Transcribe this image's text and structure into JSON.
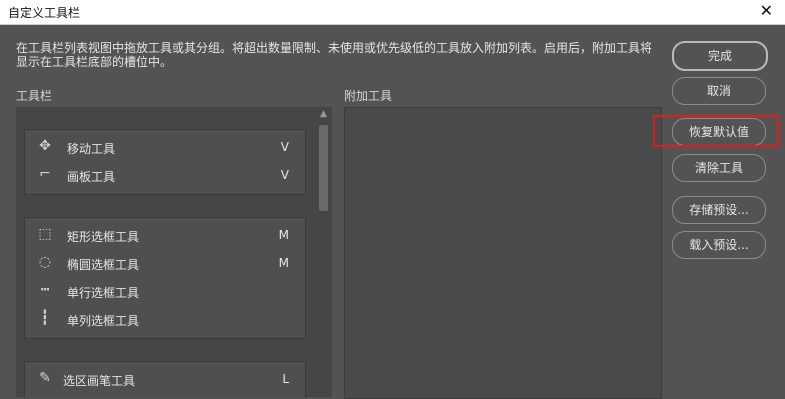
{
  "window": {
    "title": "自定义工具栏",
    "close_glyph": "✕"
  },
  "description": "在工具栏列表视图中拖放工具或其分组。将超出数量限制、未使用或优先级低的工具放入附加列表。启用后，附加工具将显示在工具栏底部的槽位中。",
  "toolbar_label": "工具栏",
  "extra_label": "附加工具",
  "groups": [
    {
      "tools": [
        {
          "icon": "move-icon",
          "glyph": "✥",
          "name": "移动工具",
          "key": "V"
        },
        {
          "icon": "artboard-icon",
          "glyph": "⌐",
          "name": "画板工具",
          "key": "V"
        }
      ]
    },
    {
      "tools": [
        {
          "icon": "rect-marquee-icon",
          "glyph": "⬚",
          "name": "矩形选框工具",
          "key": "M"
        },
        {
          "icon": "ellipse-marquee-icon",
          "glyph": "◌",
          "name": "椭圆选框工具",
          "key": "M"
        },
        {
          "icon": "single-row-marquee-icon",
          "glyph": "┅",
          "name": "单行选框工具",
          "key": ""
        },
        {
          "icon": "single-column-marquee-icon",
          "glyph": "┇",
          "name": "单列选框工具",
          "key": ""
        }
      ]
    },
    {
      "tools": [
        {
          "icon": "selection-brush-icon",
          "glyph": "✎",
          "name": "选区画笔工具",
          "key": "L"
        }
      ]
    }
  ],
  "buttons": {
    "done": "完成",
    "cancel": "取消",
    "restore_defaults": "恢复默认值",
    "clear_tools": "清除工具",
    "save_preset": "存储预设...",
    "load_preset": "载入预设..."
  },
  "highlight_color": "#e01c1c"
}
